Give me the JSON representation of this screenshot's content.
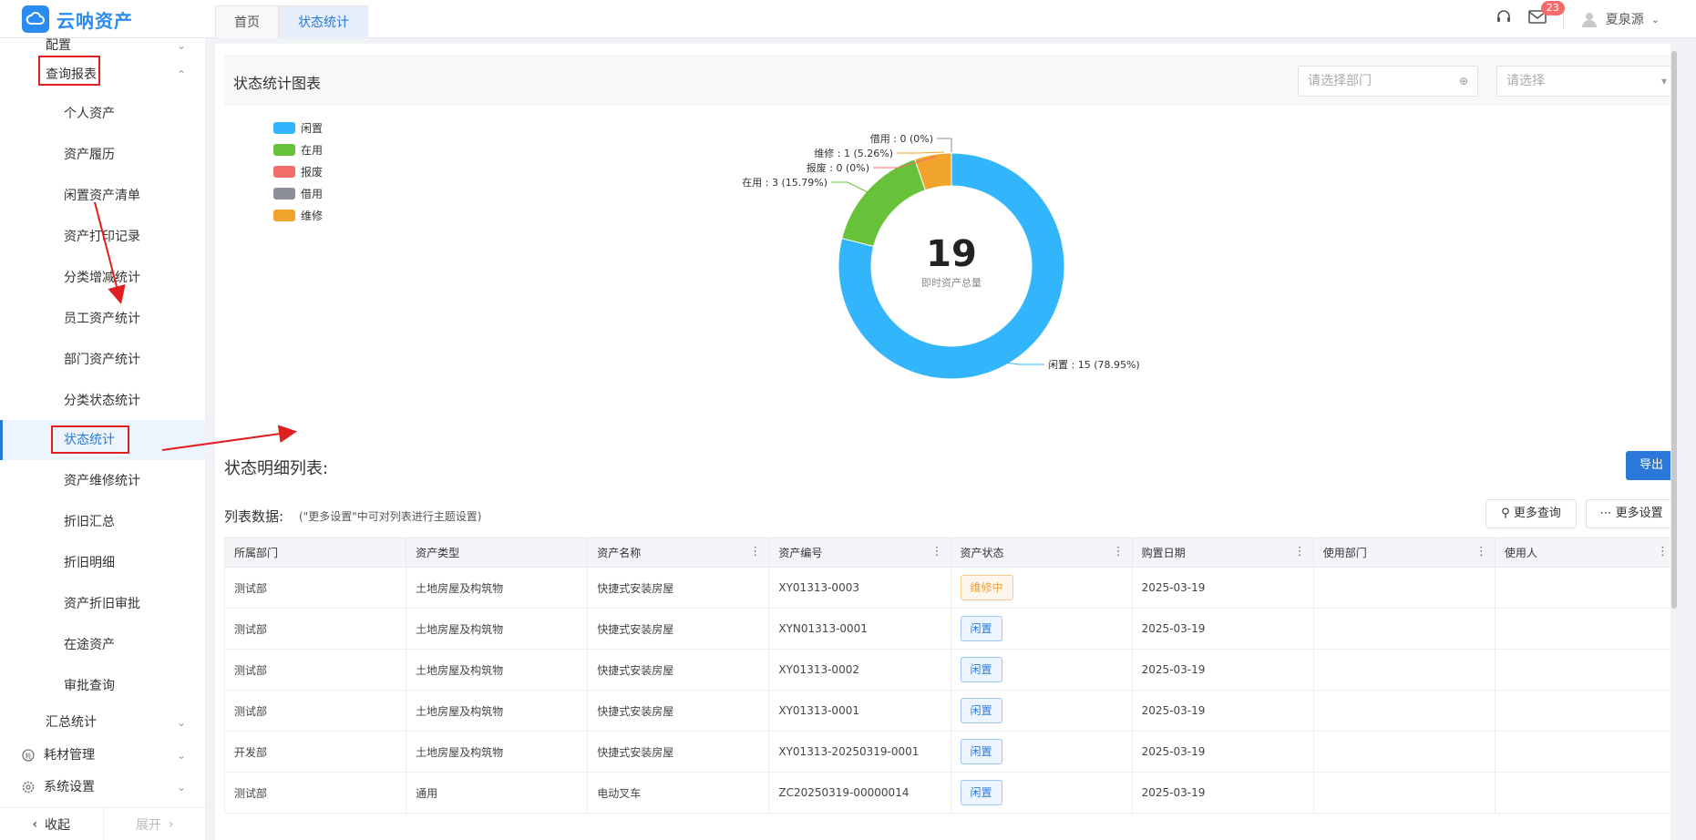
{
  "app": {
    "name": "云呐资产"
  },
  "tabs": [
    {
      "label": "首页"
    },
    {
      "label": "状态统计"
    }
  ],
  "header": {
    "mail_count": "23",
    "user_name": "夏泉源"
  },
  "sidebar": {
    "config_label": "配置",
    "query_group": "查询报表",
    "items": [
      {
        "label": "个人资产"
      },
      {
        "label": "资产履历"
      },
      {
        "label": "闲置资产清单"
      },
      {
        "label": "资产打印记录"
      },
      {
        "label": "分类增减统计"
      },
      {
        "label": "员工资产统计"
      },
      {
        "label": "部门资产统计"
      },
      {
        "label": "分类状态统计"
      },
      {
        "label": "状态统计"
      },
      {
        "label": "资产维修统计"
      },
      {
        "label": "折旧汇总"
      },
      {
        "label": "折旧明细"
      },
      {
        "label": "资产折旧审批"
      },
      {
        "label": "在途资产"
      },
      {
        "label": "审批查询"
      }
    ],
    "summary_group": "汇总统计",
    "consumables": "耗材管理",
    "system_settings": "系统设置",
    "collapse": "收起",
    "expand": "展开"
  },
  "chart_section": {
    "title": "状态统计图表",
    "dept_placeholder": "请选择部门",
    "select_placeholder": "请选择"
  },
  "chart_data": {
    "type": "pie",
    "center_value": "19",
    "center_label": "即时资产总量",
    "series": [
      {
        "name": "闲置",
        "value": 15,
        "pct": "78.95%",
        "color": "#33b5fb"
      },
      {
        "name": "在用",
        "value": 3,
        "pct": "15.79%",
        "color": "#67c23a"
      },
      {
        "name": "报废",
        "value": 0,
        "pct": "0%",
        "color": "#f56c6c"
      },
      {
        "name": "借用",
        "value": 0,
        "pct": "0%",
        "color": "#8a8f99"
      },
      {
        "name": "维修",
        "value": 1,
        "pct": "5.26%",
        "color": "#f0a42c"
      }
    ],
    "slice_labels": {
      "idle": "闲置 : 15 (78.95%)",
      "inuse": "在用 : 3 (15.79%)",
      "scrap": "报废 : 0 (0%)",
      "repair": "维修 : 1 (5.26%)",
      "borrow": "借用 : 0 (0%)"
    }
  },
  "list_section": {
    "title": "状态明细列表:",
    "export": "导出",
    "list_label": "列表数据:",
    "note": "(\"更多设置\"中可对列表进行主题设置)",
    "more_query": "更多查询",
    "more_settings": "更多设置",
    "columns": [
      "所属部门",
      "资产类型",
      "资产名称",
      "资产编号",
      "资产状态",
      "购置日期",
      "使用部门",
      "使用人"
    ],
    "rows": [
      {
        "dept": "测试部",
        "type": "土地房屋及构筑物",
        "name": "快捷式安装房屋",
        "code": "XY01313-0003",
        "status": "维修中",
        "date": "2025-03-19",
        "use_dept": "",
        "user": ""
      },
      {
        "dept": "测试部",
        "type": "土地房屋及构筑物",
        "name": "快捷式安装房屋",
        "code": "XYN01313-0001",
        "status": "闲置",
        "date": "2025-03-19",
        "use_dept": "",
        "user": ""
      },
      {
        "dept": "测试部",
        "type": "土地房屋及构筑物",
        "name": "快捷式安装房屋",
        "code": "XY01313-0002",
        "status": "闲置",
        "date": "2025-03-19",
        "use_dept": "",
        "user": ""
      },
      {
        "dept": "测试部",
        "type": "土地房屋及构筑物",
        "name": "快捷式安装房屋",
        "code": "XY01313-0001",
        "status": "闲置",
        "date": "2025-03-19",
        "use_dept": "",
        "user": ""
      },
      {
        "dept": "开发部",
        "type": "土地房屋及构筑物",
        "name": "快捷式安装房屋",
        "code": "XY01313-20250319-0001",
        "status": "闲置",
        "date": "2025-03-19",
        "use_dept": "",
        "user": ""
      },
      {
        "dept": "测试部",
        "type": "通用",
        "name": "电动叉车",
        "code": "ZC20250319-00000014",
        "status": "闲置",
        "date": "2025-03-19",
        "use_dept": "",
        "user": ""
      }
    ]
  }
}
